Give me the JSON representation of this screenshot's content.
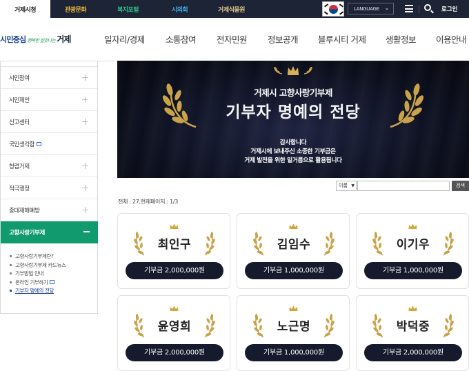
{
  "top_tabs": [
    {
      "label": "거제시청"
    },
    {
      "label": "관광문화"
    },
    {
      "label": "복지포털"
    },
    {
      "label": "시의회"
    },
    {
      "label": "거제식물원"
    }
  ],
  "utility": {
    "language_label": "LANGUAGE",
    "login_label": "로그인"
  },
  "logo": {
    "main_left": "시민중심",
    "slogan": "행복한 살맛나는",
    "city": "거제"
  },
  "gnb": [
    {
      "label": "일자리/경제"
    },
    {
      "label": "소통참여"
    },
    {
      "label": "전자민원"
    },
    {
      "label": "정보공개"
    },
    {
      "label": "블루시티 거제"
    },
    {
      "label": "생활정보"
    },
    {
      "label": "이용안내"
    }
  ],
  "sidebar": {
    "items": [
      {
        "label": "시민참여"
      },
      {
        "label": "시민제안"
      },
      {
        "label": "신고센터"
      },
      {
        "label": "국민생각함"
      },
      {
        "label": "청렴거제"
      },
      {
        "label": "적극행정"
      },
      {
        "label": "중대재해예방"
      }
    ],
    "active": {
      "label": "고향사랑기부제"
    },
    "sub_items": [
      {
        "label": "고향사랑기부제란?"
      },
      {
        "label": "고향사랑기부제 카드뉴스"
      },
      {
        "label": "기부방법 안내"
      },
      {
        "label": "온라인 기부하기"
      },
      {
        "label": "기부자 명예의 전당"
      }
    ]
  },
  "banner": {
    "title_small": "거제시 고향사랑기부제",
    "title_large": "기부자 명예의 전당",
    "line1": "감사합니다",
    "line2": "거제시에 보내주신 소중한 기부금은",
    "line3": "거제 발전을 위한 밑거름으로 활용됩니다"
  },
  "search": {
    "select_value": "이름",
    "button_label": "검색"
  },
  "total_text": "전체 : 27,현재페이지 : 1/3",
  "donors": [
    {
      "name": "최인구",
      "amount": "기부금   2,000,000원"
    },
    {
      "name": "김임수",
      "amount": "기부금   1,000,000원"
    },
    {
      "name": "이기우",
      "amount": "기부금   1,000,000원"
    },
    {
      "name": "윤영희",
      "amount": "기부금   2,000,000원"
    },
    {
      "name": "노근명",
      "amount": "기부금   1,000,000원"
    },
    {
      "name": "박덕중",
      "amount": "기부금   2,000,000원"
    }
  ],
  "colors": {
    "topbar": "#1d2435",
    "accent_green": "#109a6e",
    "card_pill": "#151b2d",
    "gold": "#c9a24a"
  }
}
